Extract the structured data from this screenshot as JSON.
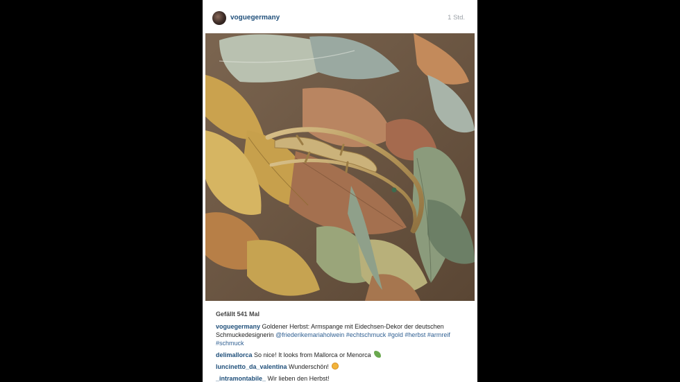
{
  "post": {
    "username": "voguegermany",
    "time": "1 Std.",
    "likes": "Gefällt 541 Mal"
  },
  "caption": {
    "user": "voguegermany",
    "text_1": "Goldener Herbst: Armspange mit Eidechsen-Dekor der deutschen Schmuckedesignerin",
    "mention": "@friederikemariaholwein",
    "tags": [
      "#echtschmuck",
      "#gold",
      "#herbst",
      "#armreif",
      "#schmuck"
    ]
  },
  "comments": [
    {
      "user": "delimallorca",
      "text": "So nice! It looks from Mallorca or Menorca",
      "emoji": "lizard-emoji"
    },
    {
      "user": "luncinetto_da_valentina",
      "text": "Wunderschön!",
      "emoji": "smile-emoji"
    },
    {
      "user": "_intramontabile_",
      "text": "Wir lieben den Herbst!"
    }
  ],
  "colors": {
    "link": "#1f4f7a",
    "hashtag": "#2f5f92",
    "background": "#000000"
  },
  "icons": [
    "avatar",
    "lizard-emoji",
    "smile-emoji"
  ]
}
